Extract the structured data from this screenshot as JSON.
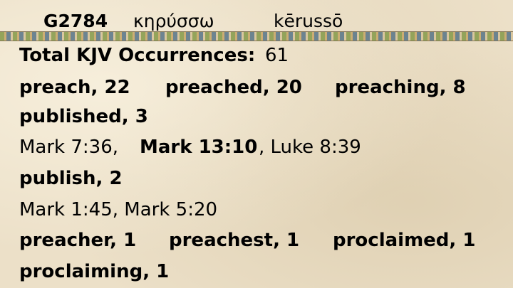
{
  "header": {
    "strong_number": "G2784",
    "greek": "κηρύσσω",
    "transliteration": "kērussō"
  },
  "total": {
    "label": "Total KJV Occurrences:",
    "value": "61"
  },
  "rows": {
    "r1": [
      "preach, 22",
      "preached, 20",
      "preaching, 8"
    ],
    "r2": [
      "published, 3"
    ],
    "r3": [
      "Mark 7:36,",
      "Mark 13:10",
      ", Luke 8:39"
    ],
    "r4": [
      "publish, 2"
    ],
    "r5": [
      "Mark 1:45, Mark 5:20"
    ],
    "r6": [
      "preacher, 1",
      "preachest, 1",
      "proclaimed, 1"
    ],
    "r7": [
      "proclaiming, 1"
    ]
  }
}
